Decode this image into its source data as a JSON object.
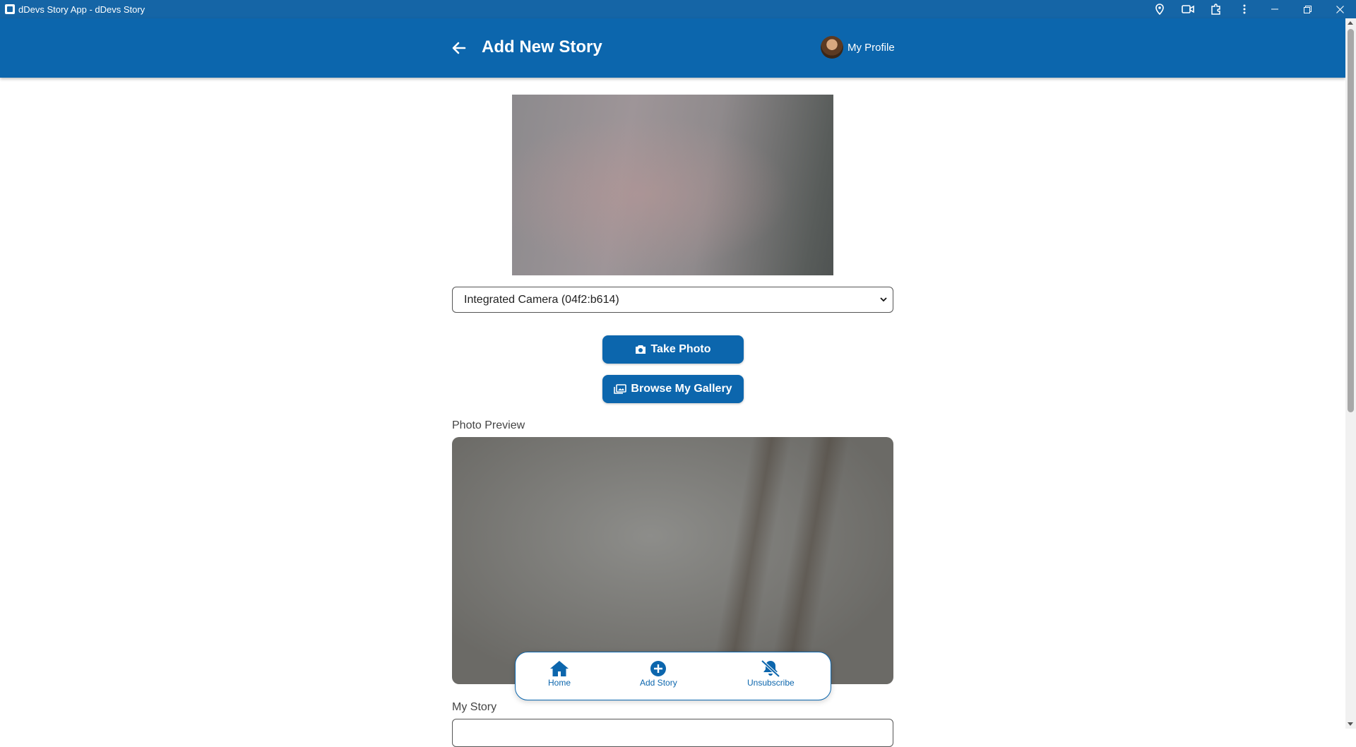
{
  "window": {
    "title": "dDevs Story App - dDevs Story",
    "toolbar_icons": [
      "location-icon",
      "camera-permission-icon",
      "extensions-icon",
      "more-vert-icon"
    ],
    "controls": [
      "minimize",
      "restore",
      "close"
    ]
  },
  "header": {
    "back_icon": "arrow-left-icon",
    "title": "Add New Story",
    "profile_label": "My Profile"
  },
  "camera": {
    "selected_device": "Integrated Camera (04f2:b614)"
  },
  "buttons": {
    "take_photo": "Take Photo",
    "browse_gallery": "Browse My Gallery"
  },
  "labels": {
    "photo_preview": "Photo Preview",
    "my_story": "My Story"
  },
  "bottom_nav": {
    "items": [
      {
        "label": "Home",
        "icon": "home-icon"
      },
      {
        "label": "Add Story",
        "icon": "plus-circle-icon"
      },
      {
        "label": "Unsubscribe",
        "icon": "bell-slash-icon"
      }
    ]
  },
  "colors": {
    "primary": "#0c66ad",
    "titlebar": "#1565a6",
    "background": "#ffffff"
  }
}
